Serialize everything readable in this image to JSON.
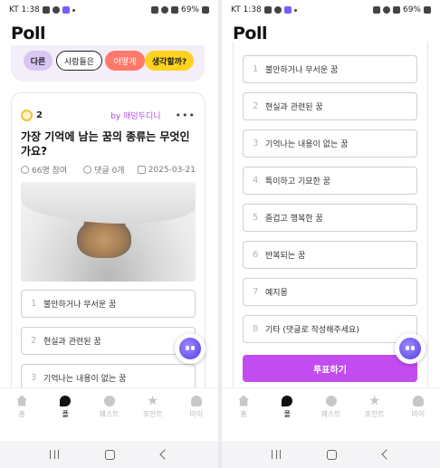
{
  "left": {
    "status": {
      "carrier_time": "KT 1:38",
      "battery": "69%"
    },
    "app_title": "Poll",
    "chips": [
      "다른",
      "사람들은",
      "어떻게",
      "생각할까?"
    ],
    "card": {
      "rank": "2",
      "author": "by 매덩두디니",
      "more": "•••",
      "question": "가장 기억에 남는 꿈의 종류는 무엇인가요?",
      "participants": "66명 참여",
      "comments": "댓글 0개",
      "date": "2025-03-21",
      "options": [
        {
          "num": "1",
          "label": "불안하거나 무서운 꿈"
        },
        {
          "num": "2",
          "label": "현실과 관련된 꿈"
        },
        {
          "num": "3",
          "label": "기억나는 내용이 없는 꿈"
        }
      ]
    }
  },
  "right": {
    "status": {
      "carrier_time": "KT 1:38",
      "battery": "69%"
    },
    "app_title": "Poll",
    "options": [
      {
        "num": "1",
        "label": "불안하거나 무서운 꿈"
      },
      {
        "num": "2",
        "label": "현실과 관련된 꿈"
      },
      {
        "num": "3",
        "label": "기억나는 내용이 없는 꿈"
      },
      {
        "num": "4",
        "label": "특이하고 기묘한 꿈"
      },
      {
        "num": "5",
        "label": "즐겁고 행복한 꿈"
      },
      {
        "num": "6",
        "label": "반복되는 꿈"
      },
      {
        "num": "7",
        "label": "예지몽"
      },
      {
        "num": "8",
        "label": "기타 (댓글로 작성해주세요)"
      }
    ],
    "vote_button": "투표하기"
  },
  "tabbar": {
    "items": [
      {
        "label": "홈",
        "icon": "home-icon",
        "active": false
      },
      {
        "label": "폴",
        "icon": "poll-icon",
        "active": true
      },
      {
        "label": "퀘스트",
        "icon": "quest-icon",
        "active": false
      },
      {
        "label": "포인트",
        "icon": "point-icon",
        "active": false
      },
      {
        "label": "마이",
        "icon": "my-icon",
        "active": false
      }
    ]
  },
  "colors": {
    "accent": "#c34cf0",
    "author": "#b04ee0",
    "chip_yellow": "#ffd21f",
    "chip_coral": "#ff7a6b",
    "chip_lavender": "#d9c6f3"
  }
}
